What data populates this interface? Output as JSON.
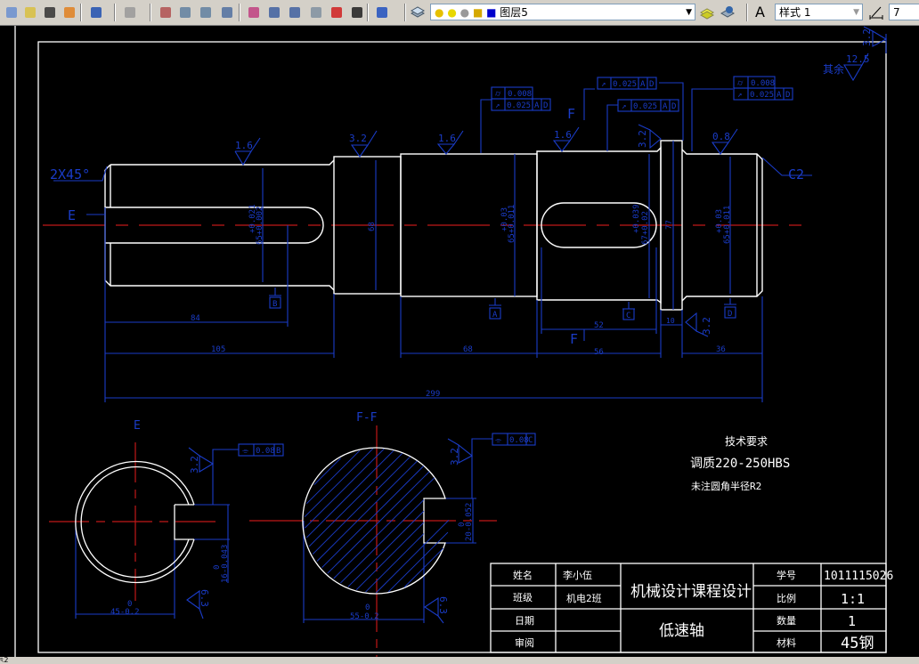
{
  "toolbar": {
    "icons": [
      "new-icon",
      "open-icon",
      "match-properties-icon",
      "quick-select-icon",
      "undo-icon",
      "redo-icon",
      "pan-icon",
      "zoom-realtime-icon",
      "zoom-window-icon",
      "zoom-previous-icon",
      "properties-icon",
      "design-center-icon",
      "tool-palettes-icon",
      "sheet-set-icon",
      "markup-icon",
      "calculator-icon",
      "help-icon"
    ],
    "layer_name": "图层5",
    "text_style": "样式 1",
    "dim_style": "7",
    "layer_color": "#0000cc"
  },
  "drawing": {
    "colors": {
      "outline": "#ffffff",
      "dimension": "#1a3cc8",
      "centerline": "#c01818"
    },
    "roughness": {
      "r1": "1.6",
      "r2": "3.2",
      "r3": "1.6",
      "r4": "1.6",
      "r5": "3.2",
      "r6": "0.8",
      "r7": "3.2",
      "general": "12.5",
      "general_prefix": "其余",
      "general_side": "3.2"
    },
    "tolerances": {
      "t1_sym": "0.008",
      "t1_run": "0.025",
      "t1_datums": [
        "A",
        "D"
      ],
      "t2_run": "0.025",
      "t2_datums": [
        "A",
        "D"
      ],
      "t3_run": "0.025",
      "t3_datums": [
        "A",
        "D"
      ],
      "t4_sym": "0.008",
      "t4_run": "0.025",
      "t4_datums": [
        "A",
        "D"
      ]
    },
    "labels": {
      "chamfer_left": "2X45°",
      "chamfer_right": "C2",
      "section_e": "E",
      "section_f": "F",
      "datum_a": "A",
      "datum_b": "B",
      "datum_c": "C",
      "datum_d": "D"
    },
    "diameters": {
      "d1_tol_upper": "+0.021",
      "d1_text": "65+0.002",
      "d2": "68",
      "d3_tol_upper": "+0.03",
      "d3_text": "65+0.011",
      "d4_tol_upper": "+0.039",
      "d4_text": "67+0.02",
      "d5": "77",
      "d6_tol_upper": "+0.03",
      "d6_text": "65+0.011"
    },
    "lengths": {
      "l84": "84",
      "l105": "105",
      "l68": "68",
      "l56": "56",
      "l52": "52",
      "l10": "10",
      "l36": "36",
      "l299": "299"
    },
    "section_e": {
      "title": "E",
      "key_tol": "0.08",
      "key_datum": "B",
      "rough": "3.2",
      "rough2": "6.3",
      "width_upper": "0",
      "width": "16-0.043",
      "dia_upper": "0",
      "dia": "45-0.2"
    },
    "section_ff": {
      "title": "F-F",
      "key_tol": "0.08",
      "key_datum": "C",
      "rough": "3.2",
      "rough2": "6.3",
      "width_upper": "0",
      "width": "20-0.052",
      "dia_upper": "0",
      "dia": "55-0.2"
    },
    "requirements": {
      "title": "技术要求",
      "line1": "调质220-250HBS",
      "line2": "未注圆角半径R2"
    }
  },
  "title_block": {
    "name_label": "姓名",
    "name": "李小伍",
    "class_label": "班级",
    "class": "机电2班",
    "date_label": "日期",
    "date": "",
    "review_label": "审阅",
    "review": "",
    "course": "机械设计课程设计",
    "part": "低速轴",
    "id_label": "学号",
    "id": "1011115026",
    "scale_label": "比例",
    "scale": "1:1",
    "qty_label": "数量",
    "qty": "1",
    "material_label": "材料",
    "material": "45钢"
  },
  "status": {
    "coords": "ঽ2"
  }
}
